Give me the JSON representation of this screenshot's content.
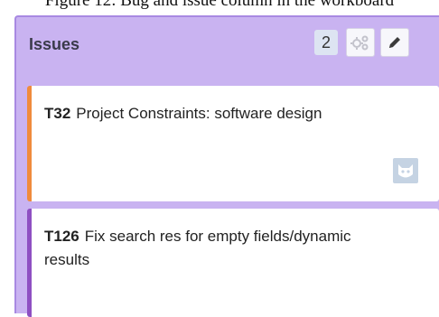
{
  "caption": "Figure 12: Bug and issue column in the workboard",
  "column": {
    "title": "Issues",
    "count": "2",
    "cards": [
      {
        "id": "T32",
        "title": "Project Constraints: software design",
        "color": "#f08b3c",
        "has_avatar": true
      },
      {
        "id": "T126",
        "title": "Fix search res for empty fields/dynamic results",
        "color": "#8e4fc2",
        "has_avatar": false
      }
    ]
  },
  "colors": {
    "column_bg": "#c9b3f1",
    "card_bg": "#ffffff"
  },
  "icons": {
    "gear": "gear-icon",
    "edit": "pencil-icon",
    "avatar": "default-avatar-icon"
  }
}
